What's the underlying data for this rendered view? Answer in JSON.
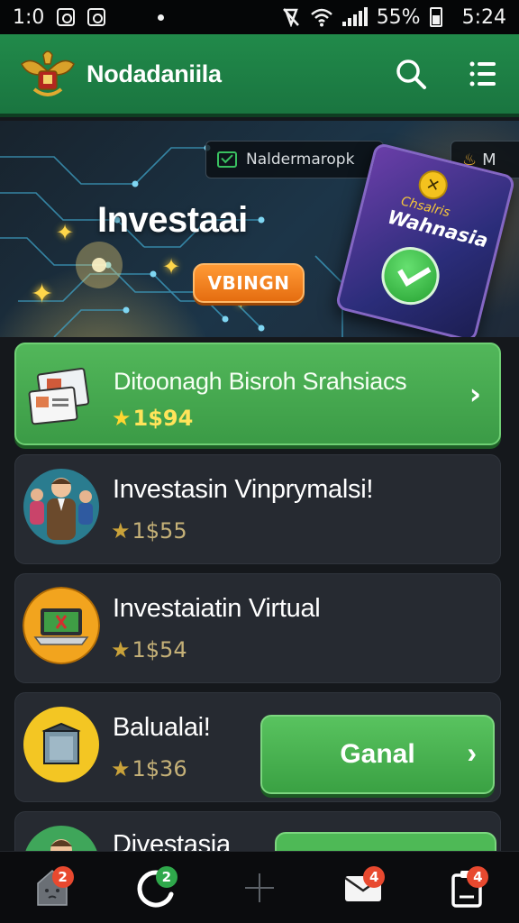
{
  "status_bar": {
    "time_left": "1:0",
    "battery": "55%",
    "time_right": "5:24"
  },
  "header": {
    "app_name": "Nodadaniila",
    "icons": [
      "garuda-logo-icon",
      "search-icon",
      "menu-icon"
    ]
  },
  "banner": {
    "chip_label": "Naldermaropk",
    "chip2_label": "M",
    "title": "Investaai",
    "button_label": "VBINGN",
    "book_subtitle": "Chsalris",
    "book_name": "Wahnasia"
  },
  "list": [
    {
      "title": "Ditoonagh Bisroh Srahsiacs",
      "price": "1$94",
      "icon": "documents-icon",
      "featured": true
    },
    {
      "title": "Investasin Vinprymalsi!",
      "price": "1$55",
      "icon": "investors-icon"
    },
    {
      "title": "Investaiatin Virtual",
      "price": "1$54",
      "icon": "laptop-icon"
    },
    {
      "title": "Balualai!",
      "price": "1$36",
      "icon": "box-icon",
      "action_label": "Ganal"
    },
    {
      "title": "Divestasia",
      "icon": "person-icon"
    }
  ],
  "bottom_nav": {
    "items": [
      {
        "icon": "home-icon",
        "badge": "2"
      },
      {
        "icon": "refresh-icon",
        "badge": "2"
      },
      {
        "icon": "add-icon",
        "badge": ""
      },
      {
        "icon": "mail-icon",
        "badge": "4"
      },
      {
        "icon": "clipboard-icon",
        "badge": "4"
      }
    ]
  },
  "colors": {
    "header_green": "#218a4a",
    "button_orange": "#f08a24",
    "card_green": "#4caf50",
    "card_dark": "#262a31"
  }
}
